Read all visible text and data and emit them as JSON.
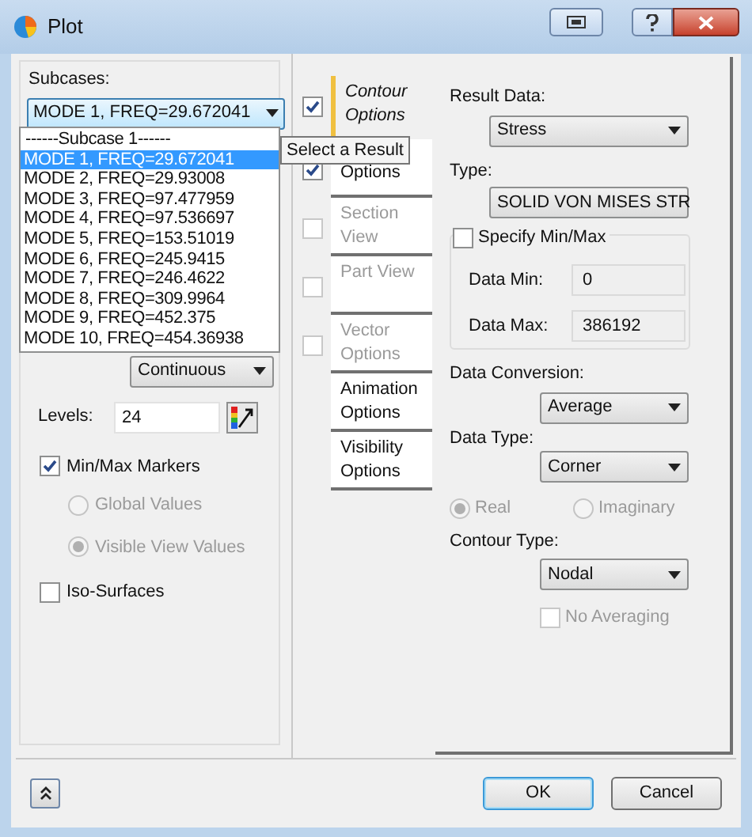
{
  "window": {
    "title": "Plot"
  },
  "subcases": {
    "label": "Subcases:",
    "value": "MODE 1, FREQ=29.672041",
    "expanded": true,
    "options": [
      {
        "text": "------Subcase 1------",
        "selected": false,
        "kind": "header"
      },
      {
        "text": "MODE 1, FREQ=29.672041",
        "selected": true,
        "kind": "item"
      },
      {
        "text": "MODE 2, FREQ=29.93008",
        "selected": false,
        "kind": "item"
      },
      {
        "text": "MODE 3, FREQ=97.477959",
        "selected": false,
        "kind": "item"
      },
      {
        "text": "MODE 4, FREQ=97.536697",
        "selected": false,
        "kind": "item"
      },
      {
        "text": "MODE 5, FREQ=153.51019",
        "selected": false,
        "kind": "item"
      },
      {
        "text": "MODE 6, FREQ=245.9415",
        "selected": false,
        "kind": "item"
      },
      {
        "text": "MODE 7, FREQ=246.4622",
        "selected": false,
        "kind": "item"
      },
      {
        "text": "MODE 8, FREQ=309.9964",
        "selected": false,
        "kind": "item"
      },
      {
        "text": "MODE 9, FREQ=452.375",
        "selected": false,
        "kind": "item"
      },
      {
        "text": "MODE 10, FREQ=454.36938",
        "selected": false,
        "kind": "item"
      }
    ]
  },
  "scale": {
    "value": "Continuous"
  },
  "levels": {
    "label": "Levels:",
    "value": "24"
  },
  "min_max_markers": {
    "label": "Min/Max Markers",
    "checked": true,
    "options": [
      {
        "label": "Global Values",
        "selected": false,
        "disabled": true
      },
      {
        "label": "Visible View Values",
        "selected": true,
        "disabled": true
      }
    ]
  },
  "iso_surfaces": {
    "label": "Iso-Surfaces",
    "checked": false
  },
  "tooltip": {
    "text": "Select a Result"
  },
  "tabs": [
    {
      "label": "Contour Options",
      "kind": "check",
      "checked": true,
      "selected": true,
      "disabled": false
    },
    {
      "label": "Options",
      "kind": "check",
      "checked": true,
      "selected": false,
      "disabled": false
    },
    {
      "label": "Section View",
      "kind": "check",
      "checked": false,
      "selected": false,
      "disabled": true
    },
    {
      "label": "Part View",
      "kind": "check",
      "checked": false,
      "selected": false,
      "disabled": true
    },
    {
      "label": "Vector Options",
      "kind": "check",
      "checked": false,
      "selected": false,
      "disabled": true
    },
    {
      "label": "Animation Options",
      "kind": "plain",
      "selected": false,
      "disabled": false
    },
    {
      "label": "Visibility Options",
      "kind": "plain",
      "selected": false,
      "disabled": false
    }
  ],
  "result_data": {
    "label": "Result Data:",
    "value": "Stress"
  },
  "type": {
    "label": "Type:",
    "value": "SOLID VON MISES STR"
  },
  "specify_min_max": {
    "label": "Specify Min/Max",
    "checked": false,
    "min_label": "Data Min:",
    "min": "0",
    "max_label": "Data Max:",
    "max": "386192"
  },
  "data_conversion": {
    "label": "Data Conversion:",
    "value": "Average"
  },
  "data_type": {
    "label": "Data Type:",
    "value": "Corner"
  },
  "value_part": [
    {
      "label": "Real",
      "selected": true,
      "disabled": true
    },
    {
      "label": "Imaginary",
      "selected": false,
      "disabled": true
    }
  ],
  "contour_type": {
    "label": "Contour Type:",
    "value": "Nodal"
  },
  "no_averaging": {
    "label": "No Averaging",
    "checked": false,
    "disabled": true
  },
  "buttons": [
    {
      "label": "OK",
      "kind": "default"
    },
    {
      "label": "Cancel",
      "kind": "normal"
    }
  ]
}
